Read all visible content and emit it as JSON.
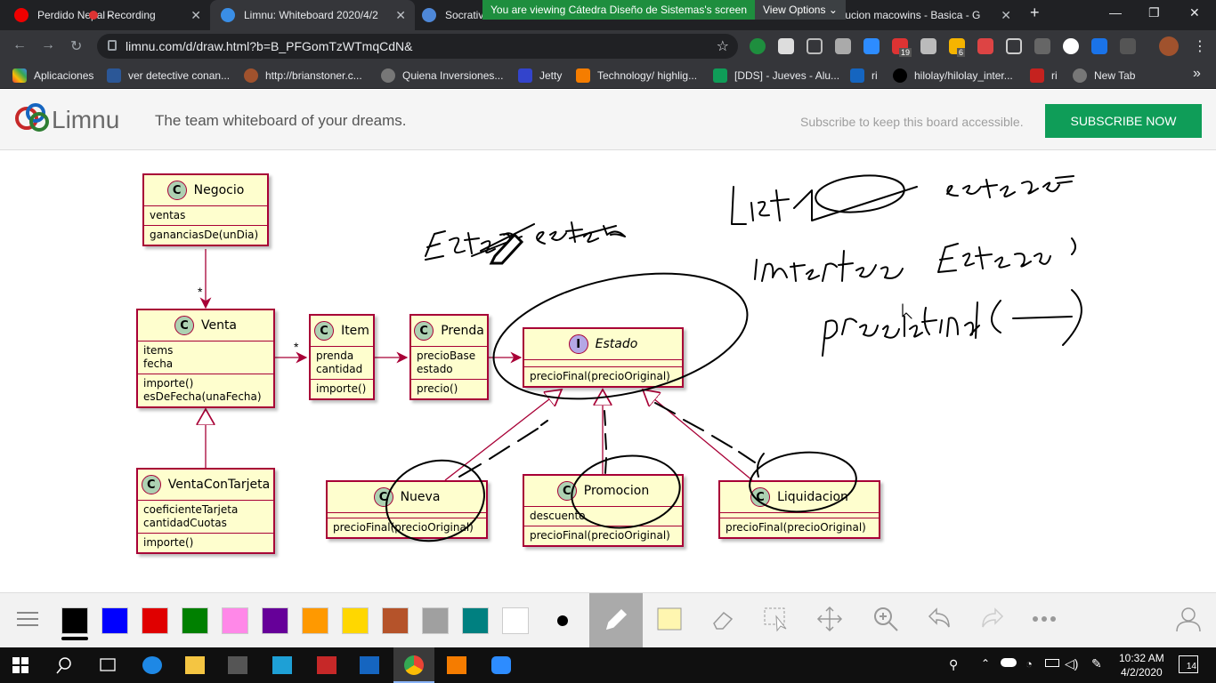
{
  "browser": {
    "tabs": [
      {
        "title": "Perdido Nepal - YouTube"
      },
      {
        "title": "Recording"
      },
      {
        "title": "Limnu: Whiteboard 2020/4/2"
      },
      {
        "title": "Socrative"
      },
      {
        "title": "solucion macowins - Basica - G"
      }
    ],
    "share_banner": "You are viewing Cátedra Diseño de Sistemas's screen",
    "view_options": "View Options",
    "url": "limnu.com/d/draw.html?b=B_PFGomTzWTmqCdN&",
    "badges": {
      "ext_a": "19",
      "ext_b": "6"
    }
  },
  "bookmarks": [
    {
      "label": "Aplicaciones"
    },
    {
      "label": "ver detective conan..."
    },
    {
      "label": "http://brianstoner.c..."
    },
    {
      "label": "Quiena Inversiones..."
    },
    {
      "label": "Jetty"
    },
    {
      "label": "Technology/ highlig..."
    },
    {
      "label": "[DDS] - Jueves - Alu..."
    },
    {
      "label": "ri"
    },
    {
      "label": "hilolay/hilolay_inter..."
    },
    {
      "label": "ri"
    },
    {
      "label": "New Tab"
    }
  ],
  "app": {
    "logo": "Limnu",
    "tagline": "The team whiteboard of your dreams.",
    "subscribe_text": "Subscribe to keep this board accessible.",
    "subscribe_button": "SUBSCRIBE NOW"
  },
  "diagram": {
    "classes": {
      "negocio": {
        "icon": "C",
        "name": "Negocio",
        "attrs": [
          "ventas"
        ],
        "methods": [
          "gananciasDe(unDia)"
        ]
      },
      "venta": {
        "icon": "C",
        "name": "Venta",
        "attrs": [
          "items",
          "fecha"
        ],
        "methods": [
          "importe()",
          "esDeFecha(unaFecha)"
        ]
      },
      "item": {
        "icon": "C",
        "name": "Item",
        "attrs": [
          "prenda",
          "cantidad"
        ],
        "methods": [
          "importe()"
        ]
      },
      "prenda": {
        "icon": "C",
        "name": "Prenda",
        "attrs": [
          "precioBase",
          "estado"
        ],
        "methods": [
          "precio()"
        ]
      },
      "estado": {
        "icon": "I",
        "name": "Estado",
        "methods": [
          "precioFinal(precioOriginal)"
        ]
      },
      "ventaConTarjeta": {
        "icon": "C",
        "name": "VentaConTarjeta",
        "attrs": [
          "coeficienteTarjeta",
          "cantidadCuotas"
        ],
        "methods": [
          "importe()"
        ]
      },
      "nueva": {
        "icon": "C",
        "name": "Nueva",
        "methods": [
          "precioFinal(precioOriginal)"
        ]
      },
      "promocion": {
        "icon": "C",
        "name": "Promocion",
        "attrs": [
          "descuento"
        ],
        "methods": [
          "precioFinal(precioOriginal)"
        ]
      },
      "liquidacion": {
        "icon": "C",
        "name": "Liquidacion",
        "methods": [
          "precioFinal(precioOriginal)"
        ]
      }
    },
    "multiplicity": {
      "negocio_venta": "*",
      "venta_item": "*"
    }
  },
  "toolbar": {
    "colors": [
      "#000000",
      "#0000ff",
      "#e00000",
      "#008000",
      "#ff88e8",
      "#660099",
      "#ff9900",
      "#ffd700",
      "#b5532a",
      "#a0a0a0",
      "#008080",
      "#ffffff"
    ],
    "tools": [
      "menu-icon",
      "dot-size-icon",
      "pencil-icon",
      "sticky-note-icon",
      "eraser-icon",
      "select-icon",
      "move-icon",
      "zoom-icon",
      "undo-icon",
      "redo-icon",
      "more-icon",
      "user-icon"
    ]
  },
  "taskbar": {
    "time": "10:32 AM",
    "date": "4/2/2020",
    "notifications": "14"
  }
}
